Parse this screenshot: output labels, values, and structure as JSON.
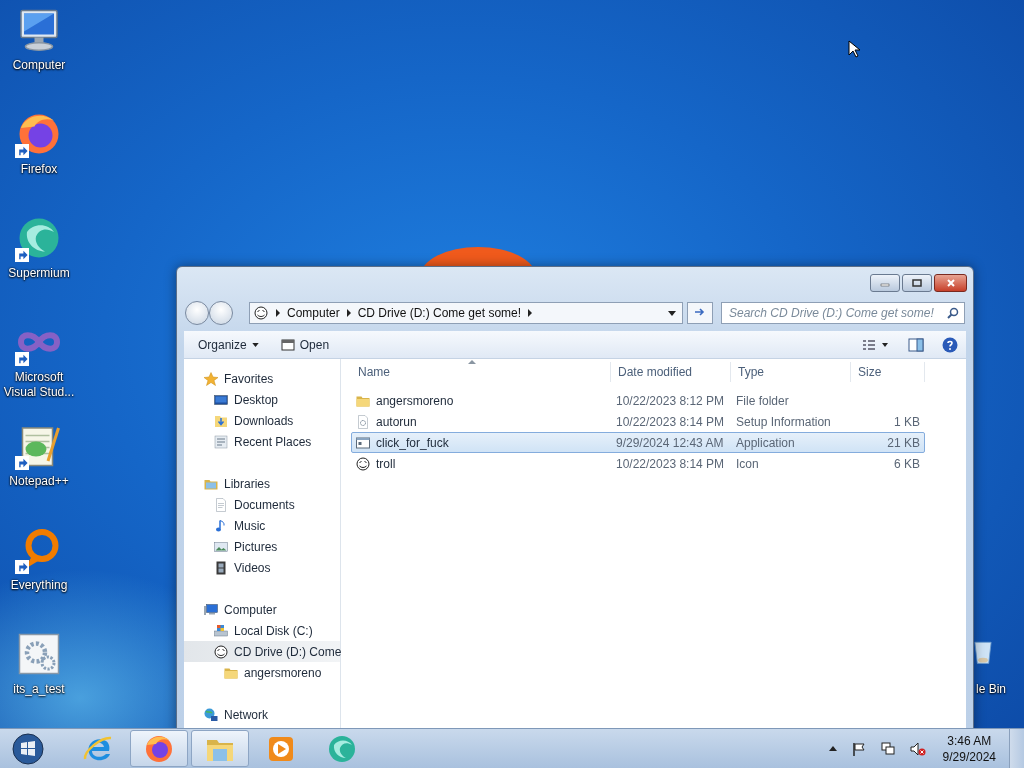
{
  "desktop": {
    "icons": [
      {
        "label": "Computer",
        "kind": "computer",
        "shortcut": false
      },
      {
        "label": "Firefox",
        "kind": "firefox",
        "shortcut": true
      },
      {
        "label": "Supermium",
        "kind": "supermium",
        "shortcut": true
      },
      {
        "label": "Microsoft Visual Stud...",
        "kind": "vs",
        "shortcut": true
      },
      {
        "label": "Notepad++",
        "kind": "notepad",
        "shortcut": true
      },
      {
        "label": "Everything",
        "kind": "everything",
        "shortcut": true
      },
      {
        "label": "its_a_test",
        "kind": "gearfile",
        "shortcut": false
      }
    ],
    "recycle_bin": {
      "label": "le Bin"
    }
  },
  "window": {
    "breadcrumb": [
      "Computer",
      "CD Drive (D:) Come get some!"
    ],
    "search": {
      "placeholder": "Search CD Drive (D:) Come get some!"
    },
    "commands": [
      "Organize",
      "Open"
    ],
    "nav_pane": [
      {
        "label": "Favorites",
        "kind": "star",
        "selected": false,
        "children": [
          {
            "label": "Desktop",
            "kind": "desktop",
            "selected": false
          },
          {
            "label": "Downloads",
            "kind": "downloads",
            "selected": false
          },
          {
            "label": "Recent Places",
            "kind": "recent",
            "selected": false
          }
        ]
      },
      {
        "label": "Libraries",
        "kind": "libraries",
        "selected": false,
        "children": [
          {
            "label": "Documents",
            "kind": "documents",
            "selected": false
          },
          {
            "label": "Music",
            "kind": "music",
            "selected": false
          },
          {
            "label": "Pictures",
            "kind": "pictures",
            "selected": false
          },
          {
            "label": "Videos",
            "kind": "videos",
            "selected": false
          }
        ]
      },
      {
        "label": "Computer",
        "kind": "pc",
        "selected": false,
        "children": [
          {
            "label": "Local Disk (C:)",
            "kind": "disk",
            "selected": false
          },
          {
            "label": "CD Drive (D:) Come",
            "kind": "troll",
            "selected": true,
            "children": [
              {
                "label": "angersmoreno",
                "kind": "folder",
                "selected": false
              }
            ]
          }
        ]
      },
      {
        "label": "Network",
        "kind": "network",
        "selected": false
      }
    ],
    "columns": [
      "Name",
      "Date modified",
      "Type",
      "Size"
    ],
    "rows": [
      {
        "name": "angersmoreno",
        "date": "10/22/2023 8:12 PM",
        "type": "File folder",
        "size": "",
        "kind": "folder",
        "selected": false
      },
      {
        "name": "autorun",
        "date": "10/22/2023 8:14 PM",
        "type": "Setup Information",
        "size": "1 KB",
        "kind": "setupfile",
        "selected": false
      },
      {
        "name": "click_for_fuck",
        "date": "9/29/2024 12:43 AM",
        "type": "Application",
        "size": "21 KB",
        "kind": "app",
        "selected": true
      },
      {
        "name": "troll",
        "date": "10/22/2023 8:14 PM",
        "type": "Icon",
        "size": "6 KB",
        "kind": "troll",
        "selected": false
      }
    ]
  },
  "taskbar": {
    "items": [
      {
        "kind": "ie",
        "open": false
      },
      {
        "kind": "firefox",
        "open": true
      },
      {
        "kind": "explorer",
        "open": true
      },
      {
        "kind": "media",
        "open": false
      },
      {
        "kind": "supermium",
        "open": false
      }
    ],
    "clock": {
      "time": "3:46 AM",
      "date": "9/29/2024"
    }
  }
}
